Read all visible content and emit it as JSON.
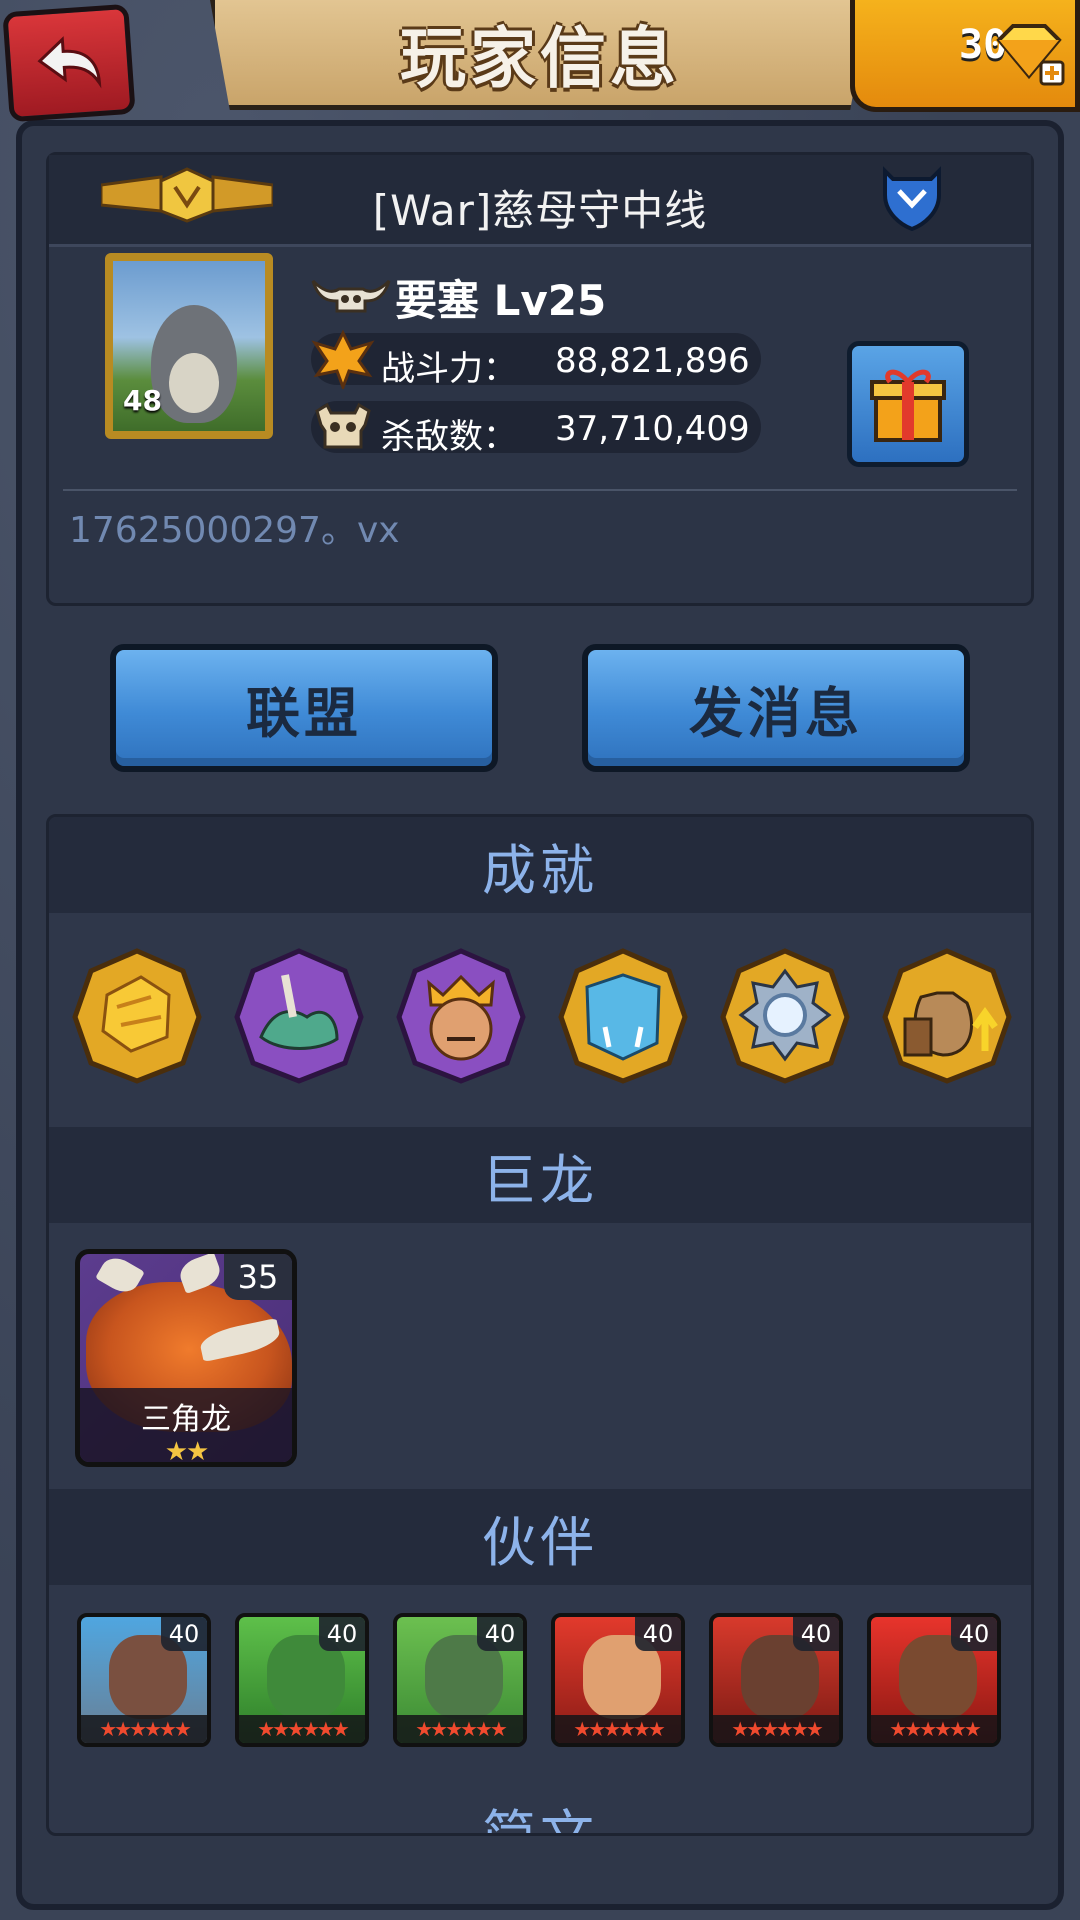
{
  "header": {
    "title": "玩家信息",
    "gem_count": "30"
  },
  "player": {
    "name": "[War]慈母守中线",
    "avatar_level": "48",
    "rank_level": "要塞 Lv25",
    "power_label": "战斗力：",
    "power_value": "88,821,896",
    "kills_label": "杀敌数：",
    "kills_value": "37,710,409",
    "bio": "17625000297。vx"
  },
  "actions": {
    "alliance_label": "联盟",
    "message_label": "发消息"
  },
  "sections": {
    "achievements_title": "成就",
    "dragons_title": "巨龙",
    "partners_title": "伙伴",
    "next_title": "简文"
  },
  "dragon": {
    "name": "三角龙",
    "level": "35",
    "stars": "★★"
  },
  "partners": [
    {
      "level": "40",
      "stars": "★★★★★★"
    },
    {
      "level": "40",
      "stars": "★★★★★★"
    },
    {
      "level": "40",
      "stars": "★★★★★★"
    },
    {
      "level": "40",
      "stars": "★★★★★★"
    },
    {
      "level": "40",
      "stars": "★★★★★★"
    },
    {
      "level": "40",
      "stars": "★★★★★★"
    }
  ],
  "colors": {
    "section_title": "#8db3ea",
    "button_blue": "#3f8ad6",
    "gem_orange": "#f5b21c",
    "back_red": "#d9363a"
  }
}
